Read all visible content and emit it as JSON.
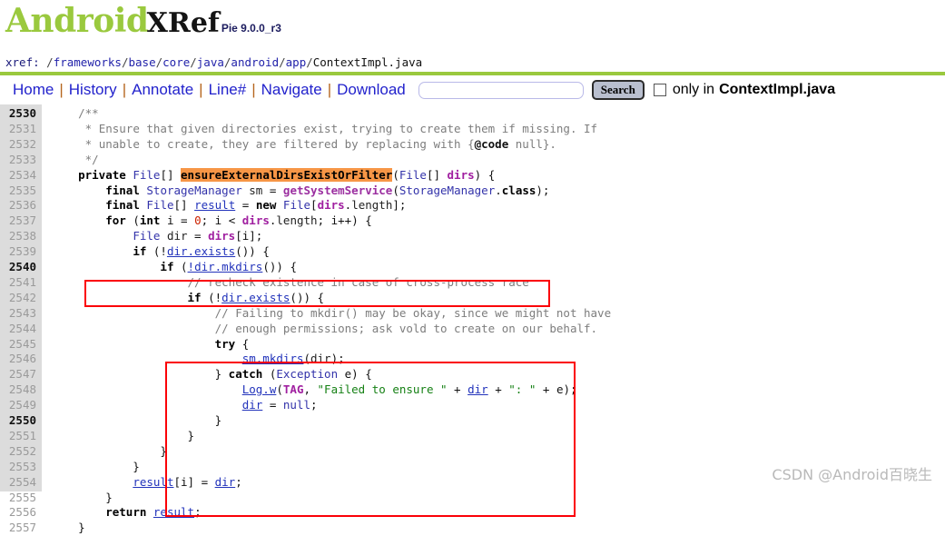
{
  "masthead": {
    "logo_primary": "Android",
    "logo_secondary": "XRef",
    "version": "Pie 9.0.0_r3"
  },
  "xref": {
    "label": "xref:",
    "path": "/frameworks/base/core/java/android/app/ContextImpl.java",
    "segments": [
      "frameworks",
      "base",
      "core",
      "java",
      "android",
      "app"
    ],
    "filename": "ContextImpl.java"
  },
  "nav": {
    "links": [
      "Home",
      "History",
      "Annotate",
      "Line#",
      "Navigate",
      "Download"
    ],
    "separator": "|",
    "search_value": "",
    "search_placeholder": "",
    "search_button": "Search",
    "only_checked": false,
    "only_label": "only in",
    "only_filename": "ContextImpl.java"
  },
  "code": {
    "first_line": 2530,
    "lines": [
      {
        "n": 2530,
        "html": "    <span class=\"cmt\">/**</span>"
      },
      {
        "n": 2531,
        "html": "     <span class=\"cmt\">* Ensure that given directories exist, trying to create them if missing. If</span>"
      },
      {
        "n": 2532,
        "html": "     <span class=\"cmt\">* unable to create, they are filtered by replacing with {</span><span class=\"cmt\" style=\"font-weight:bold;color:#111\">@code</span><span class=\"cmt\"> null}.</span>"
      },
      {
        "n": 2533,
        "html": "     <span class=\"cmt\">*/</span>"
      },
      {
        "n": 2534,
        "html": "    <span class=\"kw\">private</span> <span class=\"typ\">File</span>[] <span class=\"hl\">ensureExternalDirsExistOrFilter</span>(<span class=\"typ\">File</span>[] <span class=\"fld\">dirs</span>) {"
      },
      {
        "n": 2535,
        "html": "        <span class=\"kw\">final</span> <span class=\"typ\">StorageManager</span> <span class=\"plain\">sm</span> = <span class=\"mth\">getSystemService</span>(<span class=\"typ\">StorageManager</span>.<span class=\"kw\">class</span>);"
      },
      {
        "n": 2536,
        "html": "        <span class=\"kw\">final</span> <span class=\"typ\">File</span>[] <span class=\"lnk\">result</span> = <span class=\"kw\">new</span> <span class=\"typ\">File</span>[<span class=\"fld\">dirs</span>.<span class=\"plain\">length</span>];"
      },
      {
        "n": 2537,
        "html": "        <span class=\"kw\">for</span> (<span class=\"kw\">int</span> i = <span class=\"num\">0</span>; i &lt; <span class=\"fld\">dirs</span>.<span class=\"plain\">length</span>; i++) {"
      },
      {
        "n": 2538,
        "html": "            <span class=\"typ\">File</span> <span class=\"plain\">dir</span> = <span class=\"fld\">dirs</span>[i];"
      },
      {
        "n": 2539,
        "html": "            <span class=\"kw\">if</span> (!<span class=\"lnk\">dir.exists</span>()) {"
      },
      {
        "n": 2540,
        "html": "                <span class=\"kw\">if</span> (<span class=\"lnk\">!dir.mkdirs</span>()) {"
      },
      {
        "n": 2541,
        "html": "                    <span class=\"cmt\">// recheck existence in case of cross-process race</span>"
      },
      {
        "n": 2542,
        "html": "                    <span class=\"kw\">if</span> (!<span class=\"lnk\">dir.exists</span>()) {"
      },
      {
        "n": 2543,
        "html": "                        <span class=\"cmt\">// Failing to mkdir() may be okay, since we might not have</span>"
      },
      {
        "n": 2544,
        "html": "                        <span class=\"cmt\">// enough permissions; ask vold to create on our behalf.</span>"
      },
      {
        "n": 2545,
        "html": "                        <span class=\"kw\">try</span> {"
      },
      {
        "n": 2546,
        "html": "                            <span class=\"lnk\">sm.mkdirs</span>(<span class=\"plain\">dir</span>);"
      },
      {
        "n": 2547,
        "html": "                        } <span class=\"kw\">catch</span> (<span class=\"typ\">Exception</span> e) {"
      },
      {
        "n": 2548,
        "html": "                            <span class=\"lnk\">Log.w</span>(<span class=\"fld\">TAG</span>, <span class=\"str\">\"Failed to ensure \"</span> + <span class=\"lnk\">dir</span> + <span class=\"str\">\": \"</span> + e);"
      },
      {
        "n": 2549,
        "html": "                            <span class=\"lnk\">dir</span> = <span class=\"typ\">null</span>;"
      },
      {
        "n": 2550,
        "html": "                        }"
      },
      {
        "n": 2551,
        "html": "                    }"
      },
      {
        "n": 2552,
        "html": "                }"
      },
      {
        "n": 2553,
        "html": "            }"
      },
      {
        "n": 2554,
        "html": "            <span class=\"lnk\">result</span>[i] = <span class=\"lnk\">dir</span>;"
      },
      {
        "n": 2555,
        "html": "        }"
      },
      {
        "n": 2556,
        "html": "        <span class=\"kw\">return</span> <span class=\"lnk\">result</span>;"
      },
      {
        "n": 2557,
        "html": "    }"
      }
    ],
    "plain_text": [
      "    /**",
      "     * Ensure that given directories exist, trying to create them if missing. If",
      "     * unable to create, they are filtered by replacing with {@code null}.",
      "     */",
      "    private File[] ensureExternalDirsExistOrFilter(File[] dirs) {",
      "        final StorageManager sm = getSystemService(StorageManager.class);",
      "        final File[] result = new File[dirs.length];",
      "        for (int i = 0; i < dirs.length; i++) {",
      "            File dir = dirs[i];",
      "            if (!dir.exists()) {",
      "                if (!dir.mkdirs()) {",
      "                    // recheck existence in case of cross-process race",
      "                    if (!dir.exists()) {",
      "                        // Failing to mkdir() may be okay, since we might not have",
      "                        // enough permissions; ask vold to create on our behalf.",
      "                        try {",
      "                            sm.mkdirs(dir);",
      "                        } catch (Exception e) {",
      "                            Log.w(TAG, \"Failed to ensure \" + dir + \": \" + e);",
      "                            dir = null;",
      "                        }",
      "                    }",
      "                }",
      "            }",
      "            result[i] = dir;",
      "        }",
      "        return result;",
      "    }"
    ],
    "highlighted_symbol": "ensureExternalDirsExistOrFilter",
    "decade_lines": [
      2530,
      2540,
      2550
    ]
  },
  "annotations": {
    "boxes": [
      {
        "name": "redbox-storage-manager-init",
        "lines": "2535-2536",
        "color": "#fb0007"
      },
      {
        "name": "redbox-recheck-existence",
        "lines": "2541-2551",
        "color": "#fb0007"
      }
    ]
  },
  "watermark": {
    "text": "CSDN @Android百晓生"
  },
  "colors": {
    "brand_green": "#9ac93e",
    "link_blue": "#2222cc",
    "highlight_orange": "#f79646",
    "annotation_red": "#fb0007",
    "gutter_gray": "#dcdcdc"
  }
}
